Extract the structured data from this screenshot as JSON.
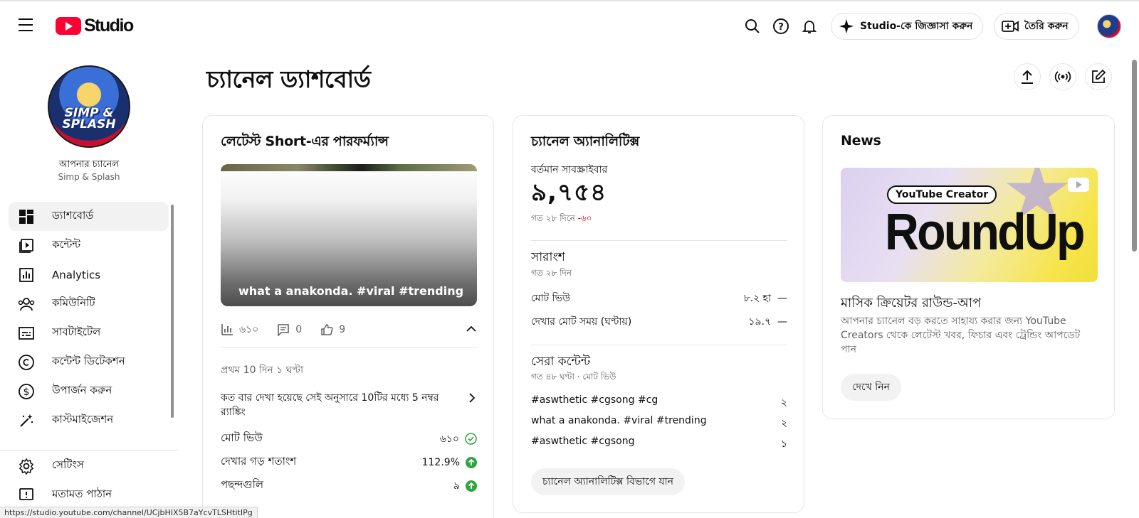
{
  "app": {
    "logo_text": "Studio",
    "brand_color": "#ff0033"
  },
  "header": {
    "ask_studio_label": "Studio-কে জিজ্ঞাসা করুন",
    "create_label": "তৈরি করুন"
  },
  "sidebar": {
    "your_channel": "আপনার চ্যানেল",
    "channel_name": "Simp & Splash",
    "avatar_text": "SIMP & SPLASH",
    "items": [
      {
        "label": "ড্যাশবোর্ড",
        "icon": "dashboard-icon",
        "active": true
      },
      {
        "label": "কন্টেন্ট",
        "icon": "content-icon"
      },
      {
        "label": "Analytics",
        "icon": "analytics-icon"
      },
      {
        "label": "কমিউনিটি",
        "icon": "community-icon"
      },
      {
        "label": "সাবটাইটেল",
        "icon": "subtitles-icon"
      },
      {
        "label": "কন্টেন্ট ডিটেকশন",
        "icon": "copyright-icon"
      },
      {
        "label": "উপার্জন করুন",
        "icon": "dollar-icon"
      },
      {
        "label": "কাস্টমাইজেশন",
        "icon": "magic-wand-icon"
      }
    ],
    "bottom": [
      {
        "label": "সেটিংস",
        "icon": "gear-icon"
      },
      {
        "label": "মতামত পাঠান",
        "icon": "feedback-icon"
      }
    ]
  },
  "main": {
    "title": "চ্যানেল ড্যাশবোর্ড"
  },
  "latest_short": {
    "title": "লেটেস্ট Short-এর পারফর্ম্যান্স",
    "video_title": "what a anakonda. #viral #trending",
    "views": "৬১০",
    "comments": "0",
    "likes": "9",
    "period": "প্রথম 10 দিন ১ ঘণ্টা",
    "ranking": "কত বার দেখা হয়েছে সেই অনুসারে 10টির মধ্যে 5 নম্বর র‍্যাঙ্কিং",
    "metrics": [
      {
        "label": "মোট ভিউ",
        "value": "৬১০",
        "status": "check"
      },
      {
        "label": "দেখার গড় শতাংশ",
        "value": "112.9%",
        "status": "up"
      },
      {
        "label": "পছন্দগুলি",
        "value": "৯",
        "status": "up"
      }
    ]
  },
  "analytics": {
    "title": "চ্যানেল অ্যানালিটিক্স",
    "subs_label": "বর্তমান সাবস্ক্রাইবার",
    "subs_count": "৯,৭৫৪",
    "subs_change_prefix": "গত ২৮ দিনে ",
    "subs_change": "-৬০",
    "summary_title": "সারাংশ",
    "summary_period": "গত ২৮ দিন",
    "summary_rows": [
      {
        "label": "মোট ভিউ",
        "value": "৮.২ হা",
        "trend": "—"
      },
      {
        "label": "দেখার মোট সময় (ঘণ্টায়)",
        "value": "১৯.৭",
        "trend": "—"
      }
    ],
    "top_title": "সেরা কন্টেন্ট",
    "top_period": "গত ৪৮ ঘণ্টা · মোট ভিউ",
    "top_rows": [
      {
        "label": "#aswthetic #cgsong #cg",
        "value": "২"
      },
      {
        "label": "what a anakonda. #viral #trending",
        "value": "২"
      },
      {
        "label": "#aswthetic #cgsong",
        "value": "১"
      }
    ],
    "button": "চ্যানেল অ্যানালিটিক্স বিভাগে যান"
  },
  "news": {
    "title": "News",
    "image_pill": "YouTube Creator",
    "image_word": "RoundUp",
    "headline": "মাসিক ক্রিয়েটর রাউন্ড-আপ",
    "description": "আপনার চ্যানেল বড় করতে সাহায্য করার জন্য YouTube Creators থেকে লেটেস্ট খবর, ফিচার এবং ট্রেন্ডিং আপডেট পান",
    "button": "দেখে নিন"
  },
  "status_url": "https://studio.youtube.com/channel/UCjbHIX5B7aYcvTLSHtitIPg"
}
